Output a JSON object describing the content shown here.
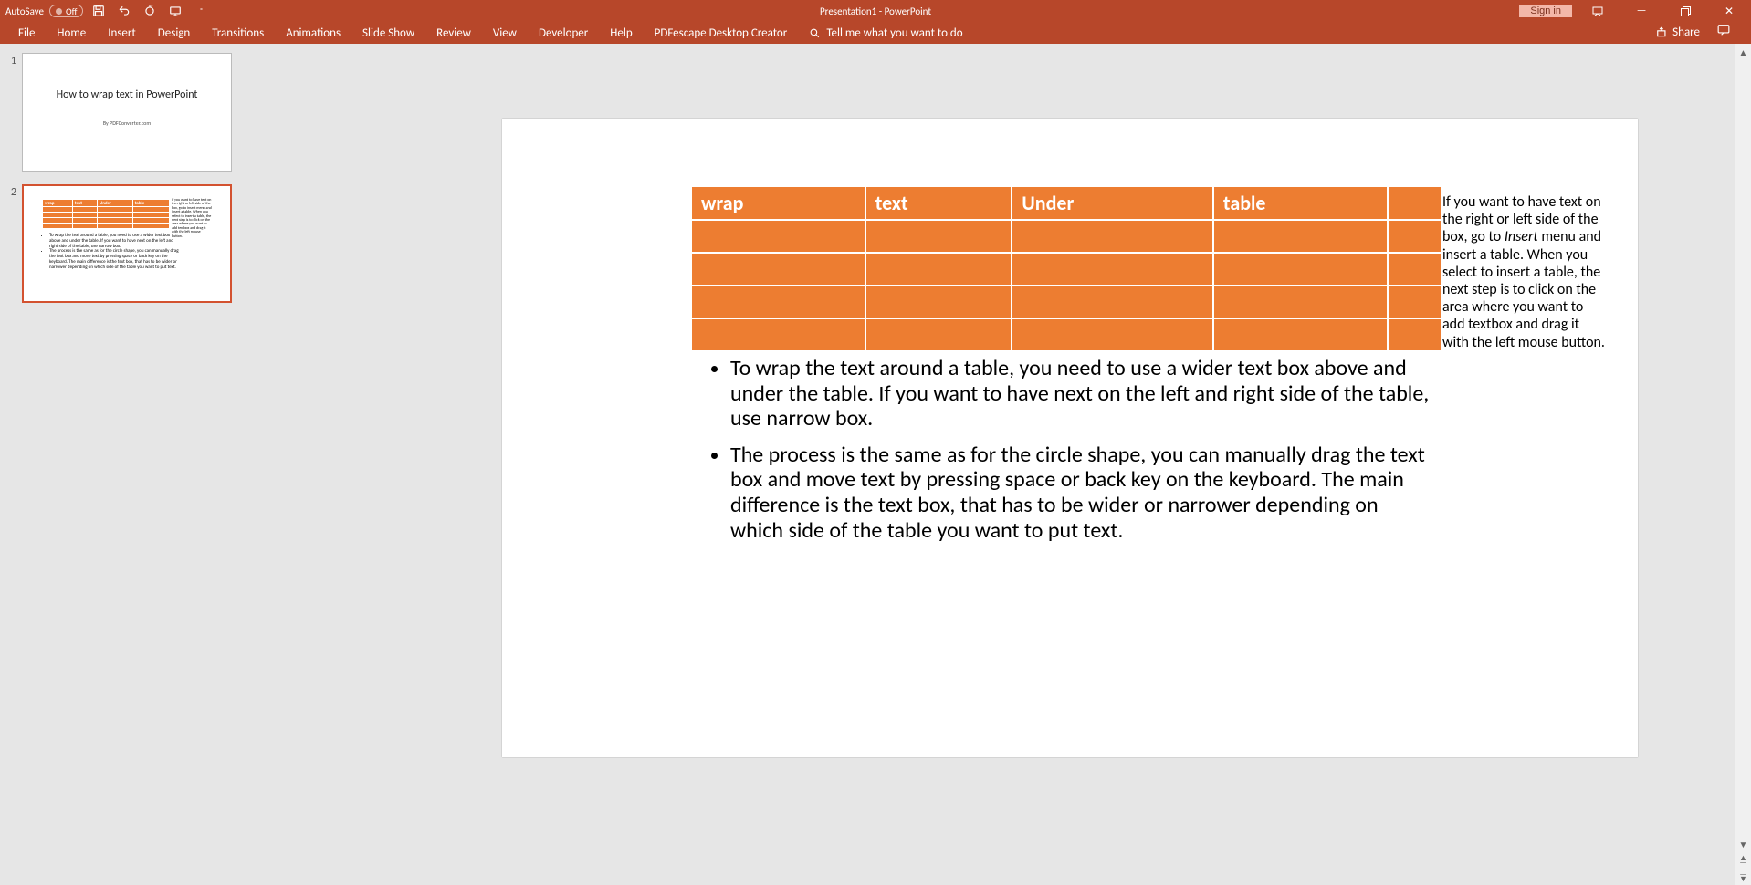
{
  "titlebar": {
    "autosave": "AutoSave",
    "autosave_state": "Off",
    "doc_title": "Presentation1 - PowerPoint",
    "signin": "Sign in"
  },
  "ribbon": {
    "tabs": [
      "File",
      "Home",
      "Insert",
      "Design",
      "Transitions",
      "Animations",
      "Slide Show",
      "Review",
      "View",
      "Developer",
      "Help",
      "PDFescape Desktop Creator"
    ],
    "tell_me": "Tell me what you want to do",
    "share": "Share"
  },
  "thumbs": {
    "items": [
      {
        "num": "1",
        "title": "How to wrap text in PowerPoint",
        "sub": "By PDFConverter.com"
      },
      {
        "num": "2"
      }
    ]
  },
  "slide": {
    "table_headers": [
      "wrap",
      "text",
      "Under",
      "table",
      ""
    ],
    "side_before": "If you want to have text on the right or left side of the box, go to ",
    "side_italic": "Insert",
    "side_after": " menu and insert a table. When you select to insert a table, the next step is to click on the area where you want to add textbox and drag it with the left mouse button.",
    "bullets": [
      "To wrap the text around a table, you need to use a wider text box above and under the table. If you want to have next on the left and right side of the table, use narrow box.",
      "The process is the same as for the circle shape, you can manually drag the text box and move text by pressing space or back key on the keyboard. The main difference is the text box, that has to be wider or narrower depending on which side of the table you want to put text."
    ]
  }
}
